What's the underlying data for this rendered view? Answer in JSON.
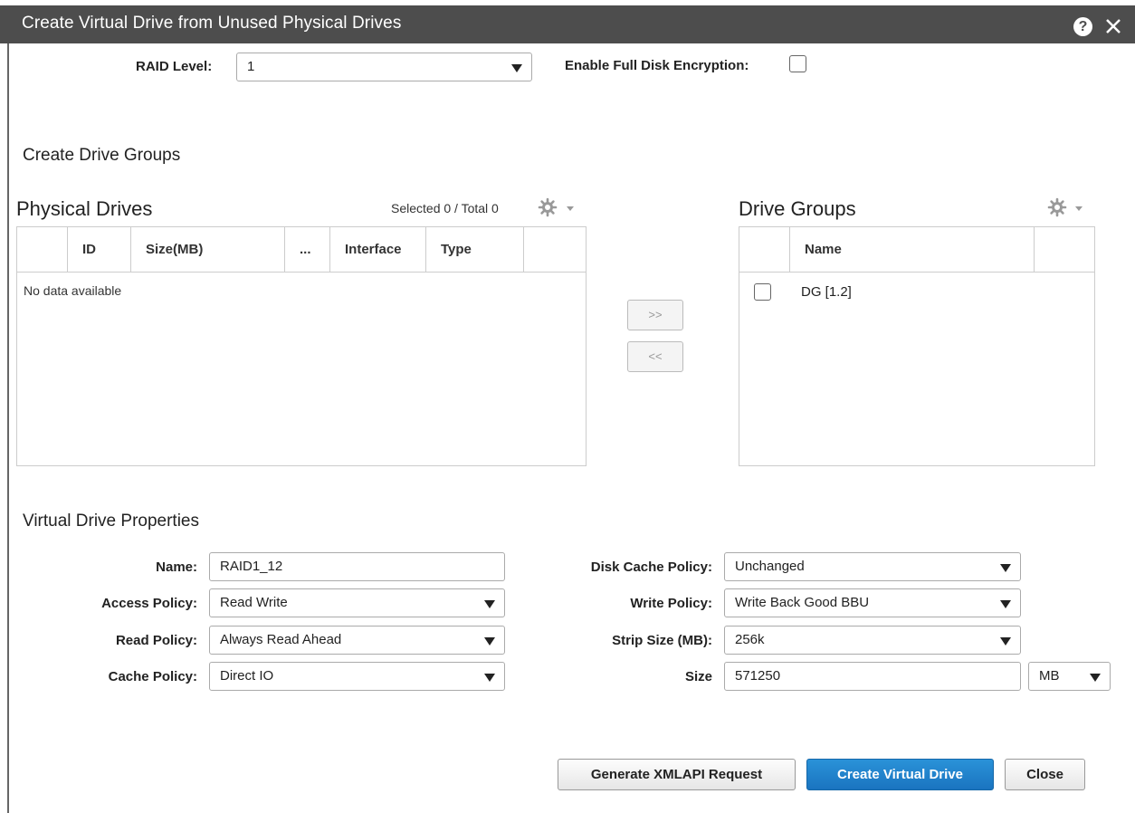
{
  "dialog": {
    "title": "Create Virtual Drive from Unused Physical Drives",
    "help_icon": "question-circle-icon",
    "close_icon": "close-icon"
  },
  "raid": {
    "label": "RAID Level:",
    "value": "1",
    "encryption_label": "Enable Full Disk Encryption:",
    "encryption_checked": false
  },
  "create_groups": {
    "title": "Create Drive Groups"
  },
  "physical_drives": {
    "title": "Physical Drives",
    "count_text": "Selected 0 / Total 0",
    "columns": [
      "ID",
      "Size(MB)",
      "...",
      "Interface",
      "Type"
    ],
    "empty_text": "No data available"
  },
  "move": {
    "add_label": ">>",
    "remove_label": "<<"
  },
  "drive_groups": {
    "title": "Drive Groups",
    "column": "Name",
    "rows": [
      {
        "name": "DG [1.2]",
        "checked": false
      }
    ]
  },
  "vd_properties": {
    "title": "Virtual Drive Properties",
    "name_label": "Name:",
    "name_value": "RAID1_12",
    "access_label": "Access Policy:",
    "access_value": "Read Write",
    "read_label": "Read Policy:",
    "read_value": "Always Read Ahead",
    "cache_label": "Cache Policy:",
    "cache_value": "Direct IO",
    "disk_cache_label": "Disk Cache Policy:",
    "disk_cache_value": "Unchanged",
    "write_label": "Write Policy:",
    "write_value": "Write Back Good BBU",
    "strip_label": "Strip Size (MB):",
    "strip_value": "256k",
    "size_label": "Size",
    "size_value": "571250",
    "size_unit": "MB"
  },
  "buttons": {
    "xmlapi": "Generate XMLAPI Request",
    "create": "Create Virtual Drive",
    "close": "Close"
  },
  "colors": {
    "titlebar": "#4d4d4d",
    "primary": "#1a74c0"
  }
}
